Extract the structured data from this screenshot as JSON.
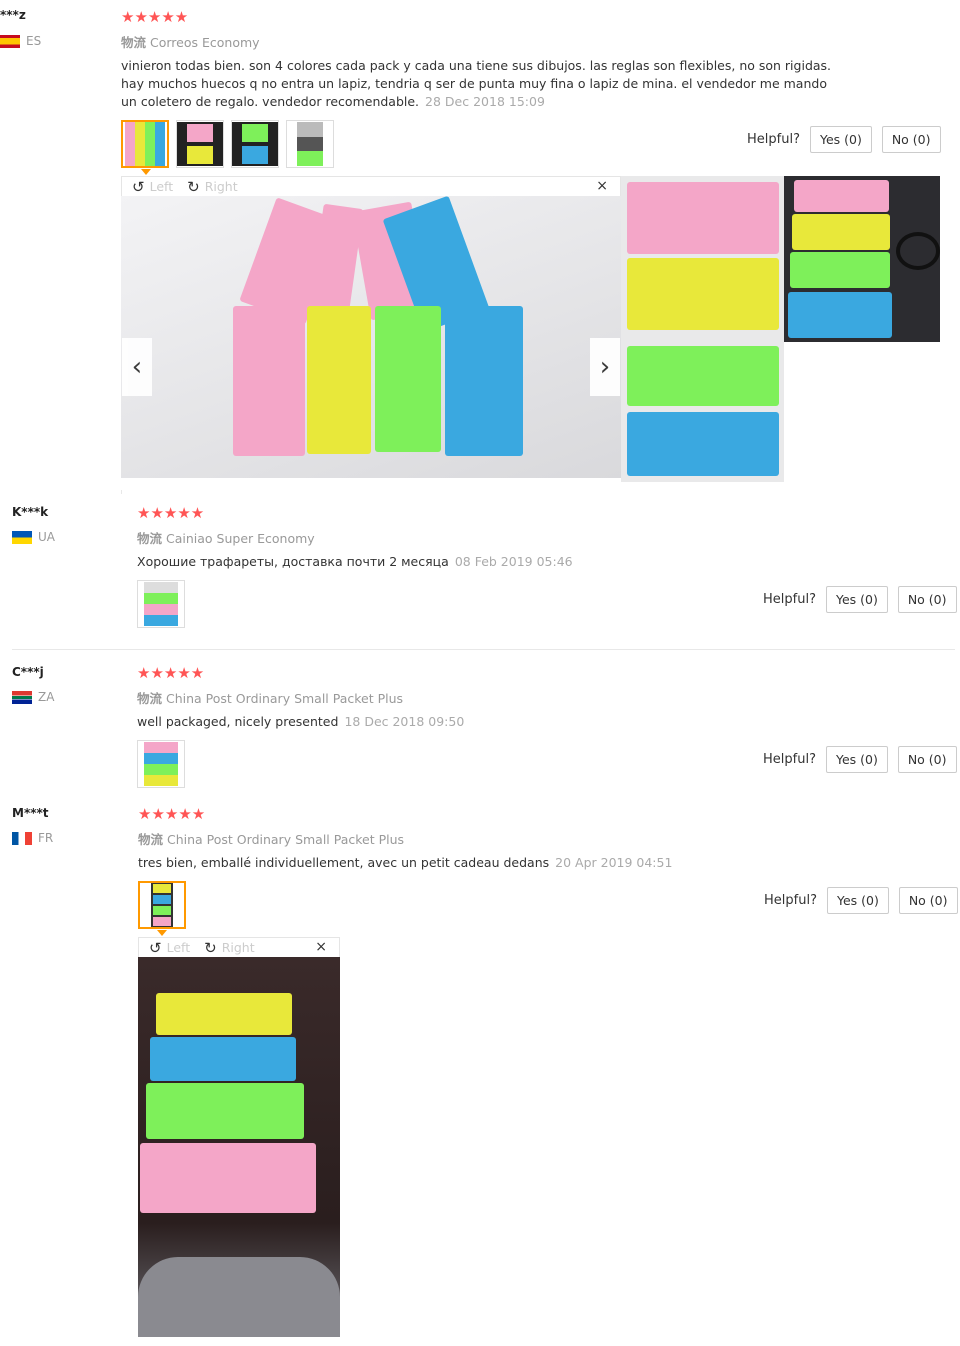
{
  "reviews": [
    {
      "user": "***z",
      "country": "ES",
      "stars": "★★★★★",
      "ship_label": "物流",
      "ship_method": "Correos Economy",
      "text": "vinieron todas bien. son 4 colores cada pack y cada una tiene sus dibujos. las reglas son flexibles, no son rigidas. hay muchos huecos q no entra un lapiz, tendria q ser de punta muy fina o lapiz de mina. el vendedor me mando un coletero de regalo. vendedor recomendable.",
      "date": "28 Dec 2018 15:09",
      "helpful": "Helpful?",
      "yes": "Yes (0)",
      "no": "No (0)"
    },
    {
      "user": "K***k",
      "country": "UA",
      "stars": "★★★★★",
      "ship_label": "物流",
      "ship_method": "Cainiao Super Economy",
      "text": "Хорошие трафареты, доставка почти 2 месяца",
      "date": "08 Feb 2019 05:46",
      "helpful": "Helpful?",
      "yes": "Yes (0)",
      "no": "No (0)"
    },
    {
      "user": "C***j",
      "country": "ZA",
      "stars": "★★★★★",
      "ship_label": "物流",
      "ship_method": "China Post Ordinary Small Packet Plus",
      "text": "well packaged, nicely presented",
      "date": "18 Dec 2018 09:50",
      "helpful": "Helpful?",
      "yes": "Yes (0)",
      "no": "No (0)"
    },
    {
      "user": "M***t",
      "country": "FR",
      "stars": "★★★★★",
      "ship_label": "物流",
      "ship_method": "China Post Ordinary Small Packet Plus",
      "text": "tres bien, emballé individuellement, avec un petit cadeau dedans",
      "date": "20 Apr 2019 04:51",
      "helpful": "Helpful?",
      "yes": "Yes (0)",
      "no": "No (0)"
    }
  ],
  "viewer": {
    "left_label": "Left",
    "right_label": "Right",
    "close": "×",
    "rotate_left_icon": "↺",
    "rotate_right_icon": "↻",
    "prev_icon": "‹",
    "next_icon": "›"
  },
  "colors": {
    "star": "#ff5555",
    "active_thumb": "#ff9900",
    "pink": "#f4a6c8",
    "yellow": "#e8e83a",
    "green": "#7ef05a",
    "blue": "#3aa8e0"
  }
}
